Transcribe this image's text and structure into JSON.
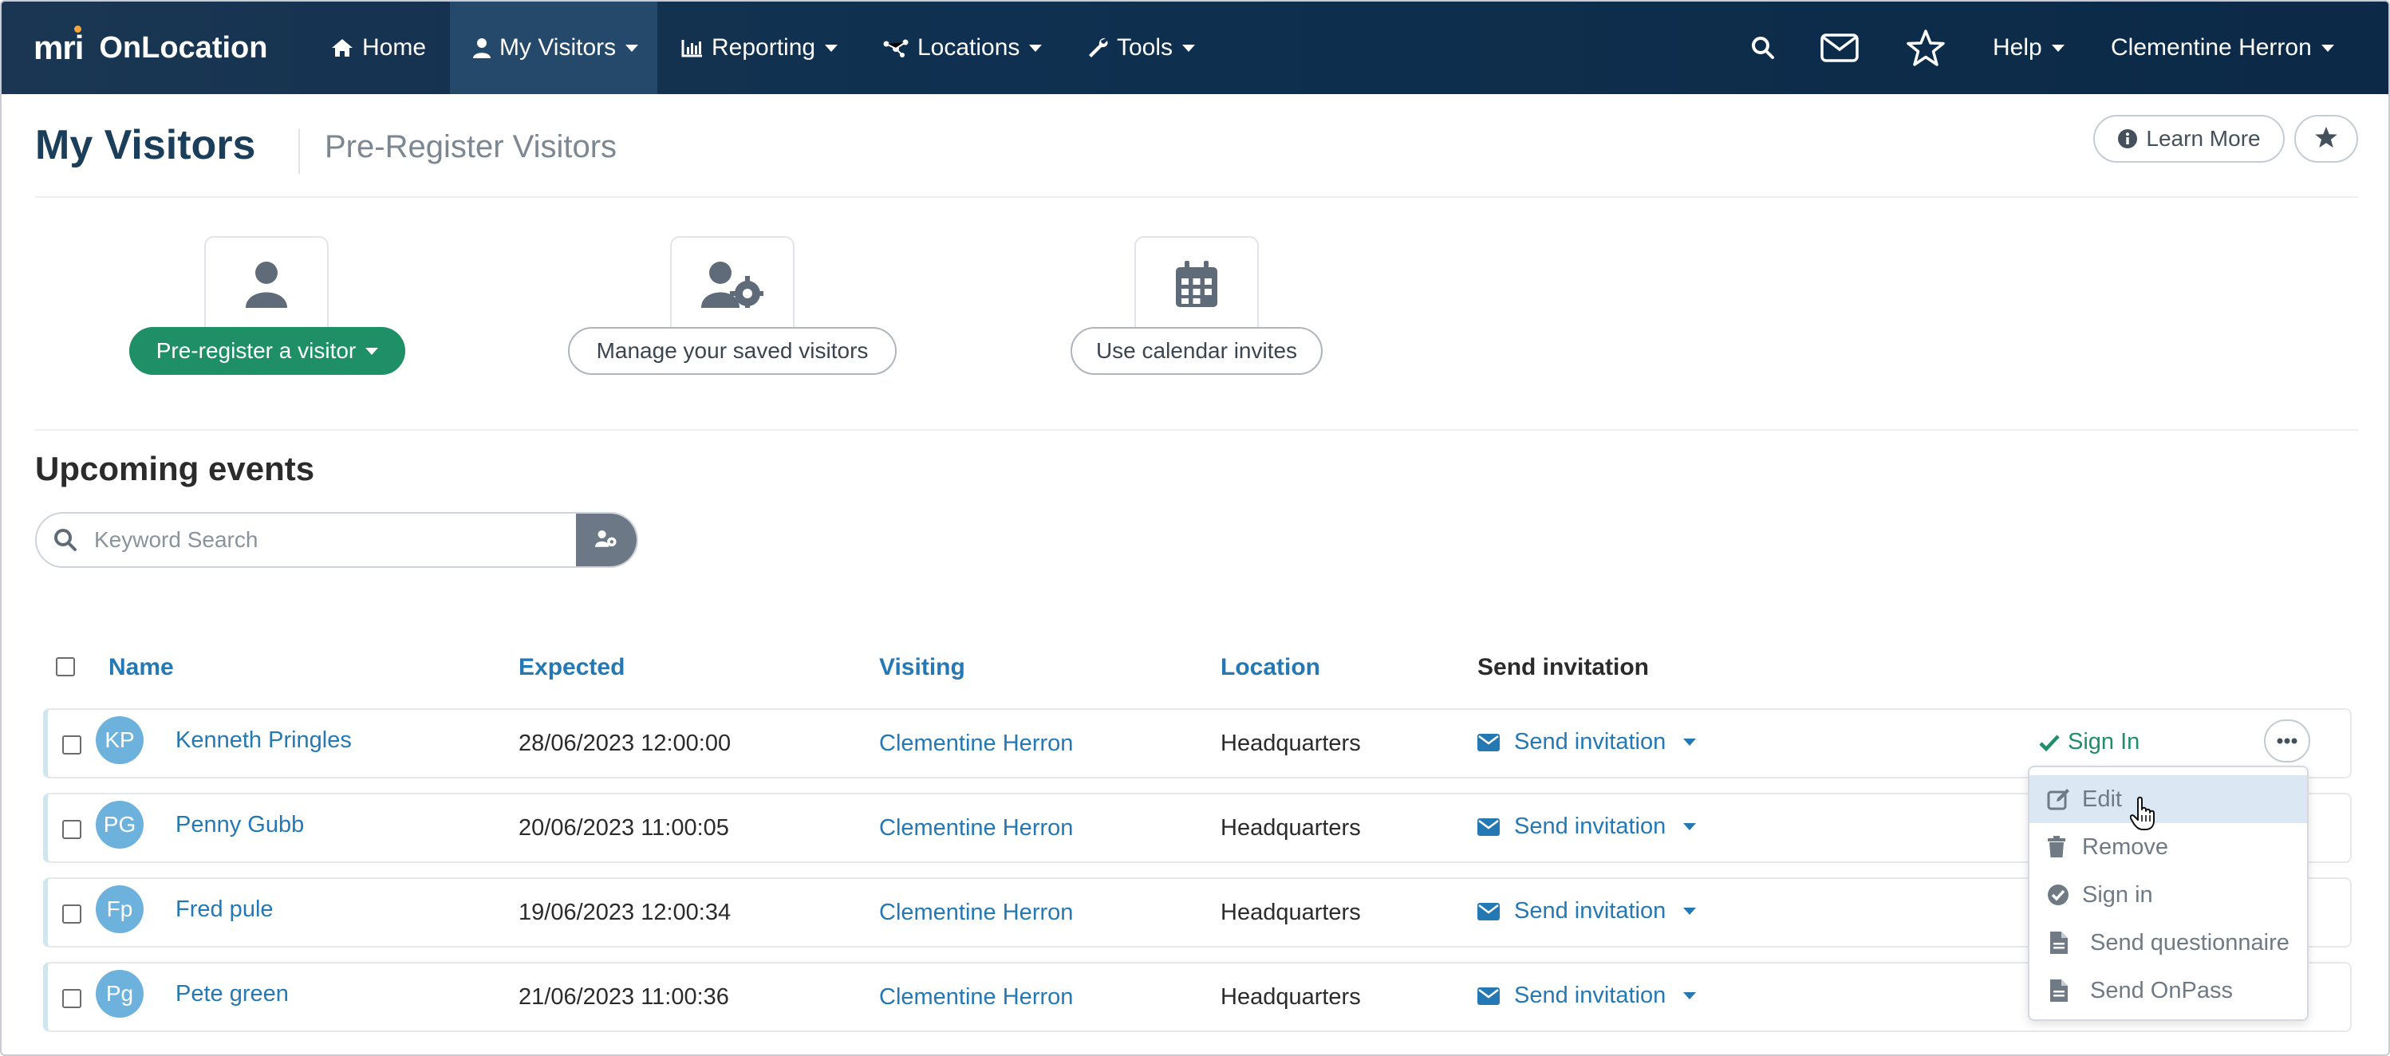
{
  "app": {
    "logo_mark": "mri",
    "name": "OnLocation"
  },
  "nav": {
    "home": "Home",
    "my_visitors": "My Visitors",
    "reporting": "Reporting",
    "locations": "Locations",
    "tools": "Tools",
    "help": "Help",
    "user": "Clementine Herron"
  },
  "header": {
    "title": "My Visitors",
    "subtitle": "Pre-Register Visitors",
    "learn_more": "Learn More"
  },
  "actions": {
    "pre_register": "Pre-register a visitor",
    "manage_saved": "Manage your saved visitors",
    "calendar": "Use calendar invites"
  },
  "events": {
    "title": "Upcoming events",
    "search_placeholder": "Keyword Search",
    "columns": {
      "name": "Name",
      "expected": "Expected",
      "visiting": "Visiting",
      "location": "Location",
      "send_invitation": "Send invitation"
    },
    "rows": [
      {
        "initials": "KP",
        "name": "Kenneth Pringles",
        "expected": "28/06/2023 12:00:00",
        "visiting": "Clementine Herron",
        "location": "Headquarters",
        "send": "Send invitation"
      },
      {
        "initials": "PG",
        "name": "Penny Gubb",
        "expected": "20/06/2023 11:00:05",
        "visiting": "Clementine Herron",
        "location": "Headquarters",
        "send": "Send invitation"
      },
      {
        "initials": "Fp",
        "name": "Fred pule",
        "expected": "19/06/2023 12:00:34",
        "visiting": "Clementine Herron",
        "location": "Headquarters",
        "send": "Send invitation"
      },
      {
        "initials": "Pg",
        "name": "Pete green",
        "expected": "21/06/2023 11:00:36",
        "visiting": "Clementine Herron",
        "location": "Headquarters",
        "send": "Send invitation"
      }
    ],
    "sign_in_label": "Sign In"
  },
  "row_menu": {
    "edit": "Edit",
    "remove": "Remove",
    "sign_in": "Sign in",
    "send_questionnaire": "Send questionnaire",
    "send_onpass": "Send OnPass"
  },
  "colors": {
    "nav_bg": "#0f3050",
    "link": "#2478b4",
    "primary_green": "#1f8f67",
    "title": "#1b3e5a",
    "avatar": "#6cb2dc"
  }
}
